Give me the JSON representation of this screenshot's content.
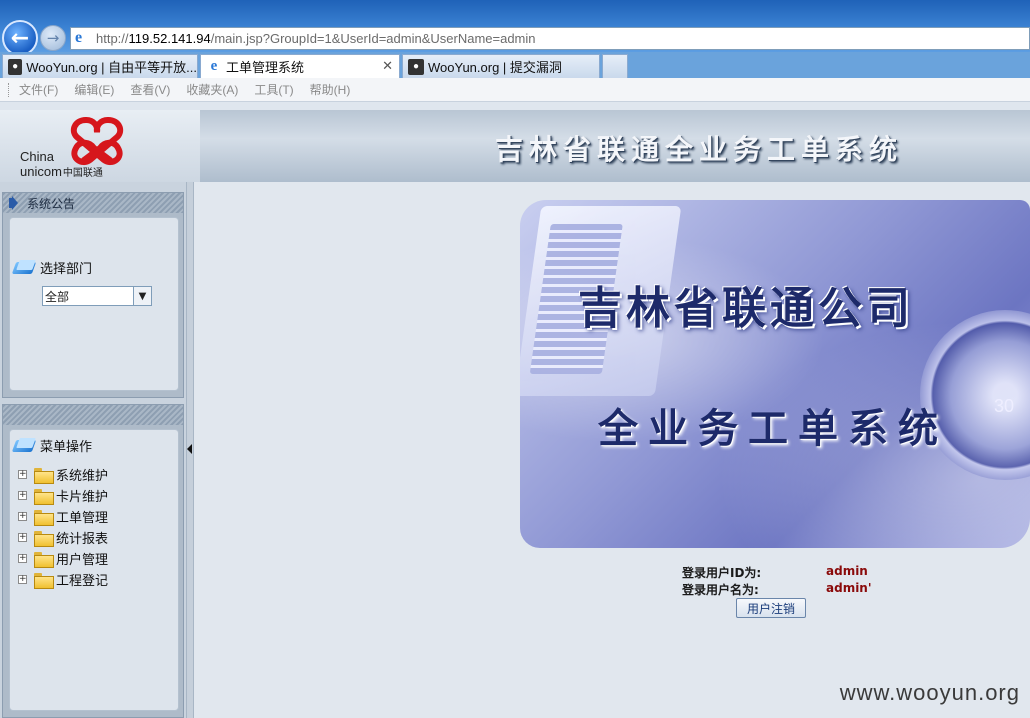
{
  "browser": {
    "address_url_prefix": "http://",
    "address_url_host": "119.52.141.94",
    "address_url_path": "/main.jsp?GroupId=1&UserId=admin&UserName=admin",
    "tabs": [
      {
        "label": "WooYun.org | 自由平等开放..."
      },
      {
        "label": "工单管理系统"
      },
      {
        "label": "WooYun.org | 提交漏洞"
      }
    ],
    "menu": [
      "文件(F)",
      "编辑(E)",
      "查看(V)",
      "收藏夹(A)",
      "工具(T)",
      "帮助(H)"
    ]
  },
  "header": {
    "logo_china": "China",
    "logo_unicom": "unicom",
    "logo_cn": "中国联通",
    "system_title": "吉林省联通全业务工单系统"
  },
  "sidebar": {
    "notice_title": "系统公告",
    "dept_label": "选择部门",
    "dept_selected": "全部",
    "menu_title": "菜单操作",
    "menu_items": [
      {
        "label": "系统维护"
      },
      {
        "label": "卡片维护"
      },
      {
        "label": "工单管理"
      },
      {
        "label": "统计报表"
      },
      {
        "label": "用户管理"
      },
      {
        "label": "工程登记"
      }
    ]
  },
  "main": {
    "hero_title": "吉林省联通公司",
    "hero_subtitle": "全业务工单系统",
    "hero_dial_number": "30",
    "login_id_label": "登录用户ID为:",
    "login_id_value": "admin",
    "login_name_label": "登录用户名为:",
    "login_name_value": "admin'",
    "logout_label": "用户注销"
  },
  "watermark": "www.wooyun.org",
  "colors": {
    "unicom_red": "#d6161c",
    "value_red": "#8a0a0a",
    "hero_title": "#1d2a6a"
  }
}
